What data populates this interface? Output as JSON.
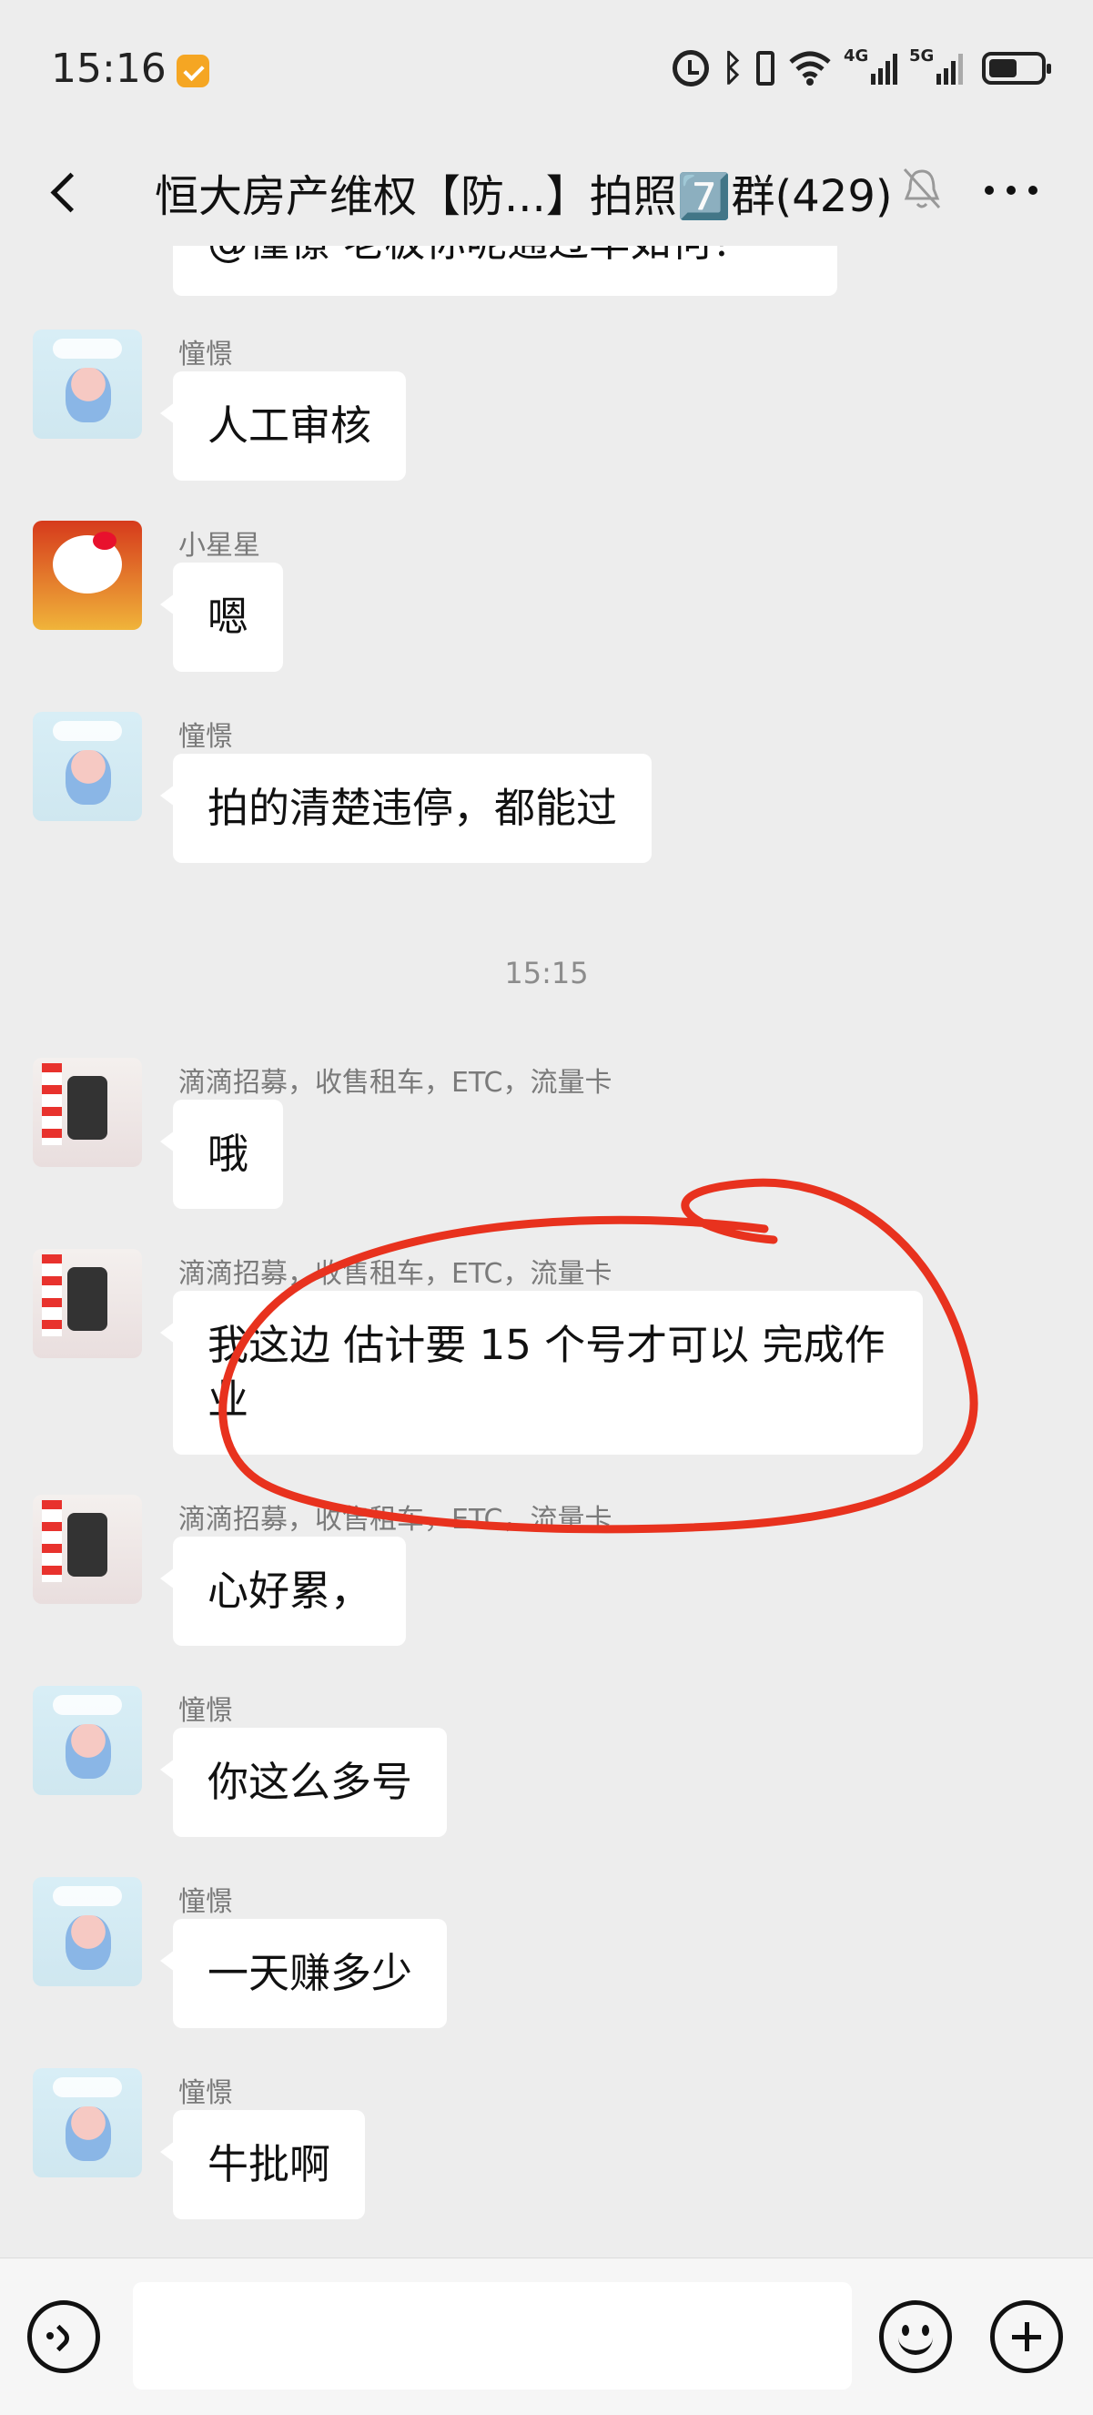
{
  "status_bar": {
    "time": "15:16",
    "signal_1_label": "4G",
    "signal_2_label": "5G",
    "icons": [
      "app-notification-icon",
      "alarm-icon",
      "bluetooth-icon",
      "vibrate-icon",
      "wifi-icon",
      "signal-4g-icon",
      "signal-5g-icon",
      "battery-icon"
    ]
  },
  "header": {
    "title": "恒大房产维权【防...】拍照7️⃣群(429)",
    "icons": [
      "back-icon",
      "mute-icon",
      "more-icon"
    ]
  },
  "messages": [
    {
      "sender": "",
      "text": "@憧憬 老板你呢通过率如何？",
      "partial": true
    },
    {
      "sender": "憧憬",
      "text": "人工审核",
      "avatar": "pig-avatar"
    },
    {
      "sender": "小星星",
      "text": "嗯",
      "avatar": "hello-kitty-avatar"
    },
    {
      "sender": "憧憬",
      "text": "拍的清楚违停，都能过",
      "avatar": "pig-avatar"
    },
    {
      "timestamp": "15:15"
    },
    {
      "sender": "滴滴招募，收售租车，ETC，流量卡",
      "text": "哦",
      "avatar": "card-avatar"
    },
    {
      "sender": "滴滴招募，收售租车，ETC，流量卡",
      "text": "我这边 估计要 15 个号才可以 完成作业",
      "avatar": "card-avatar",
      "annotated": true
    },
    {
      "sender": "滴滴招募，收售租车，ETC，流量卡",
      "text": "心好累，",
      "avatar": "card-avatar"
    },
    {
      "sender": "憧憬",
      "text": "你这么多号",
      "avatar": "pig-avatar"
    },
    {
      "sender": "憧憬",
      "text": "一天赚多少",
      "avatar": "pig-avatar"
    },
    {
      "sender": "憧憬",
      "text": "牛批啊",
      "avatar": "pig-avatar"
    }
  ],
  "input_bar": {
    "placeholder": "",
    "icons": [
      "voice-icon",
      "emoji-icon",
      "plus-icon"
    ]
  },
  "colors": {
    "background": "#ededed",
    "bubble": "#ffffff",
    "annotation_stroke": "#e8321e",
    "sender_text": "#7a7a7a"
  }
}
